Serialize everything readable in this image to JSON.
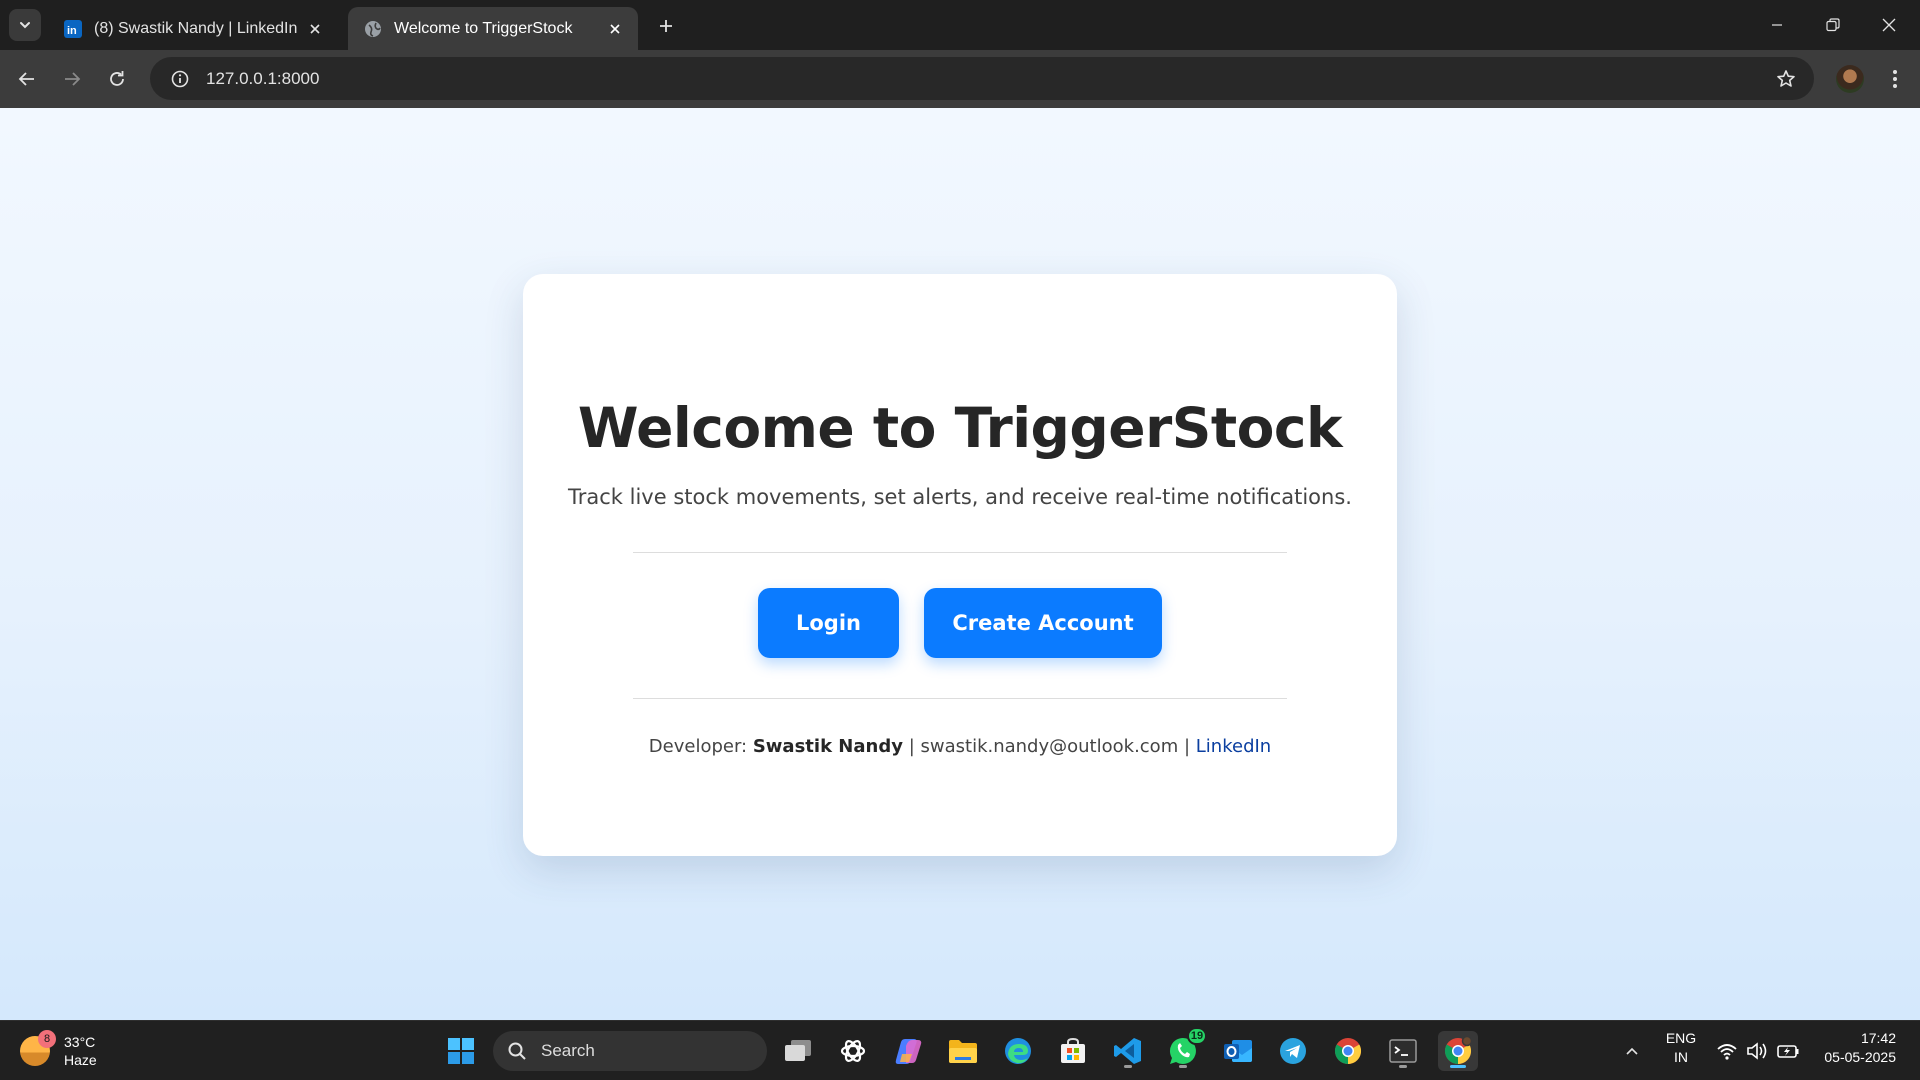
{
  "browser": {
    "tabs": [
      {
        "title": "(8) Swastik Nandy | LinkedIn",
        "favicon": "linkedin-icon",
        "active": false
      },
      {
        "title": "Welcome to TriggerStock",
        "favicon": "globe-icon",
        "active": true
      }
    ],
    "address": "127.0.0.1:8000"
  },
  "page": {
    "title": "Welcome to TriggerStock",
    "tagline": "Track live stock movements, set alerts, and receive real-time notifications.",
    "login_label": "Login",
    "create_label": "Create Account",
    "footer": {
      "prefix": "Developer:",
      "name": "Swastik Nandy",
      "sep1": "|",
      "email": "swastik.nandy@outlook.com",
      "sep2": "|",
      "link": "LinkedIn"
    },
    "colors": {
      "primary": "#0b7bff",
      "title": "#262626",
      "link": "#0b3fa0"
    }
  },
  "taskbar": {
    "weather": {
      "badge": "8",
      "temp": "33°C",
      "condition": "Haze"
    },
    "search_label": "Search",
    "apps": [
      "task-view-icon",
      "chatgpt-icon",
      "copilot-icon",
      "file-explorer-icon",
      "edge-icon",
      "store-icon",
      "vscode-icon",
      "whatsapp-icon",
      "outlook-icon",
      "telegram-icon",
      "chrome-icon",
      "terminal-icon",
      "chrome-profile-icon"
    ],
    "whatsapp_badge": "19",
    "language": {
      "line1": "ENG",
      "line2": "IN"
    },
    "clock": {
      "time": "17:42",
      "date": "05-05-2025"
    }
  }
}
